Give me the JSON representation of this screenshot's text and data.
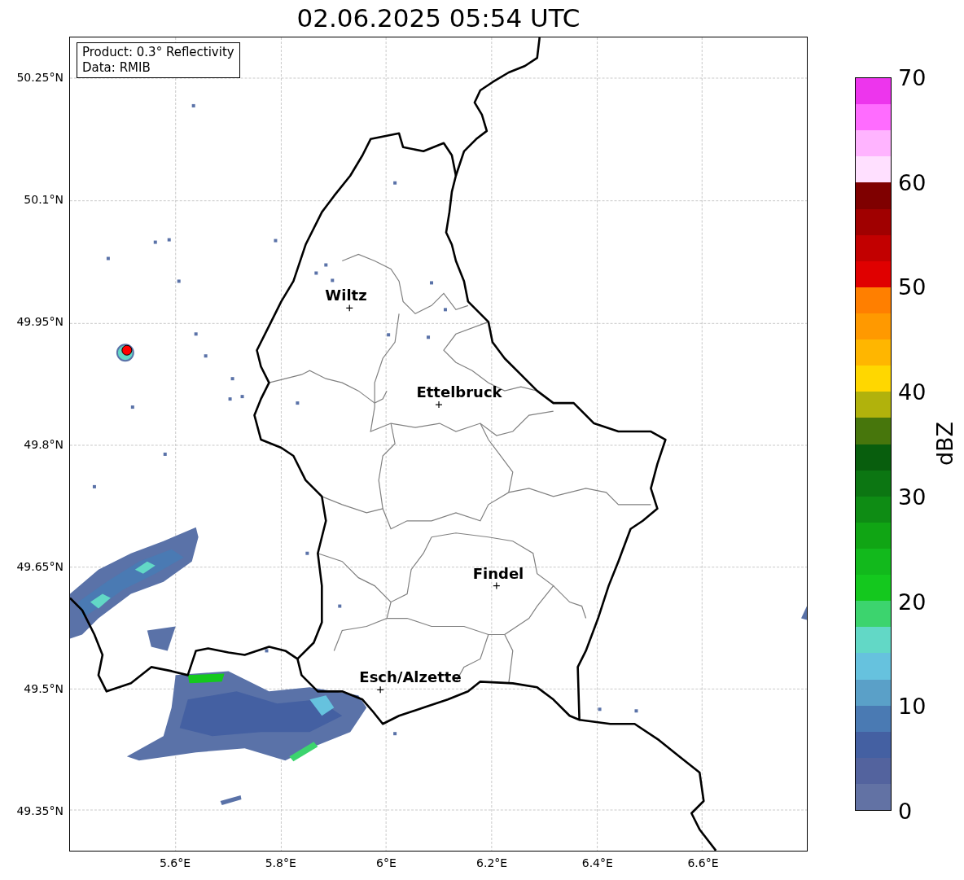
{
  "title": "02.06.2025 05:54 UTC",
  "info": [
    "Product: 0.3° Reflectivity",
    "Data: RMIB"
  ],
  "lat_ticks": [
    "50.25°N",
    "50.1°N",
    "49.95°N",
    "49.8°N",
    "49.65°N",
    "49.5°N",
    "49.35°N"
  ],
  "lon_ticks": [
    "5.6°E",
    "5.8°E",
    "6°E",
    "6.2°E",
    "6.4°E",
    "6.6°E"
  ],
  "cities": [
    {
      "name": "Wiltz"
    },
    {
      "name": "Ettelbruck"
    },
    {
      "name": "Findel"
    },
    {
      "name": "Esch/Alzette"
    }
  ],
  "colorbar": {
    "label": "dBZ",
    "ticks": [
      "70",
      "60",
      "50",
      "40",
      "30",
      "20",
      "10",
      "0"
    ],
    "bins": [
      {
        "color": "#ed35ed"
      },
      {
        "color": "#ff6cff"
      },
      {
        "color": "#ffb4ff"
      },
      {
        "color": "#ffe0ff"
      },
      {
        "color": "#7f0000"
      },
      {
        "color": "#a00000"
      },
      {
        "color": "#c20000"
      },
      {
        "color": "#e00000"
      },
      {
        "color": "#ff7f00"
      },
      {
        "color": "#ff9900"
      },
      {
        "color": "#ffb600"
      },
      {
        "color": "#ffd700"
      },
      {
        "color": "#b1b20c"
      },
      {
        "color": "#47760c"
      },
      {
        "color": "#085e0d"
      },
      {
        "color": "#0c7612"
      },
      {
        "color": "#0e8c14"
      },
      {
        "color": "#10a514"
      },
      {
        "color": "#12b91c"
      },
      {
        "color": "#14c81e"
      },
      {
        "color": "#3cd46e"
      },
      {
        "color": "#62d8c6"
      },
      {
        "color": "#66c2de"
      },
      {
        "color": "#5aa0c8"
      },
      {
        "color": "#4a7ab3"
      },
      {
        "color": "#4460a2"
      },
      {
        "color": "#53639e"
      },
      {
        "color": "#6272a4"
      }
    ]
  }
}
